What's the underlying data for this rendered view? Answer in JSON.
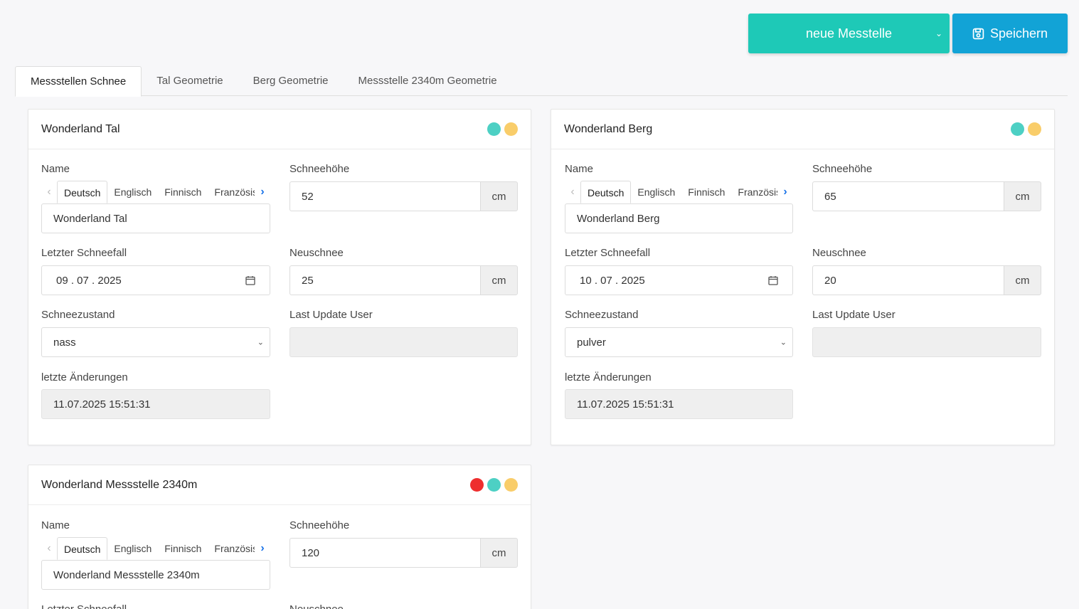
{
  "toolbar": {
    "new_label": "neue Messtelle",
    "save_label": "Speichern"
  },
  "tabs": [
    {
      "label": "Messstellen Schnee"
    },
    {
      "label": "Tal Geometrie"
    },
    {
      "label": "Berg Geometrie"
    },
    {
      "label": "Messstelle 2340m Geometrie"
    }
  ],
  "labels": {
    "name": "Name",
    "snow_height": "Schneehöhe",
    "last_snowfall": "Letzter Schneefall",
    "new_snow": "Neuschnee",
    "snow_condition": "Schneezustand",
    "last_update_user": "Last Update User",
    "last_changes": "letzte Änderungen",
    "unit": "cm"
  },
  "languages": [
    "Deutsch",
    "Englisch",
    "Finnisch",
    "Französisch"
  ],
  "colors": {
    "red": "#ee2e2e",
    "teal": "#4dd0c4",
    "yellow": "#f9cd6a"
  },
  "cards": [
    {
      "title": "Wonderland Tal",
      "name_value": "Wonderland Tal",
      "snow_height": "52",
      "last_snowfall": "09 . 07 . 2025",
      "new_snow": "25",
      "snow_condition": "nass",
      "last_update_user": "",
      "last_changes": "11.07.2025 15:51:31"
    },
    {
      "title": "Wonderland Berg",
      "name_value": "Wonderland Berg",
      "snow_height": "65",
      "last_snowfall": "10 . 07 . 2025",
      "new_snow": "20",
      "snow_condition": "pulver",
      "last_update_user": "",
      "last_changes": "11.07.2025 15:51:31"
    },
    {
      "title": "Wonderland Messstelle 2340m",
      "name_value": "Wonderland Messstelle 2340m",
      "snow_height": "120",
      "last_snowfall_label": "Letzter Schneefall",
      "new_snow_label": "Neuschnee"
    }
  ]
}
